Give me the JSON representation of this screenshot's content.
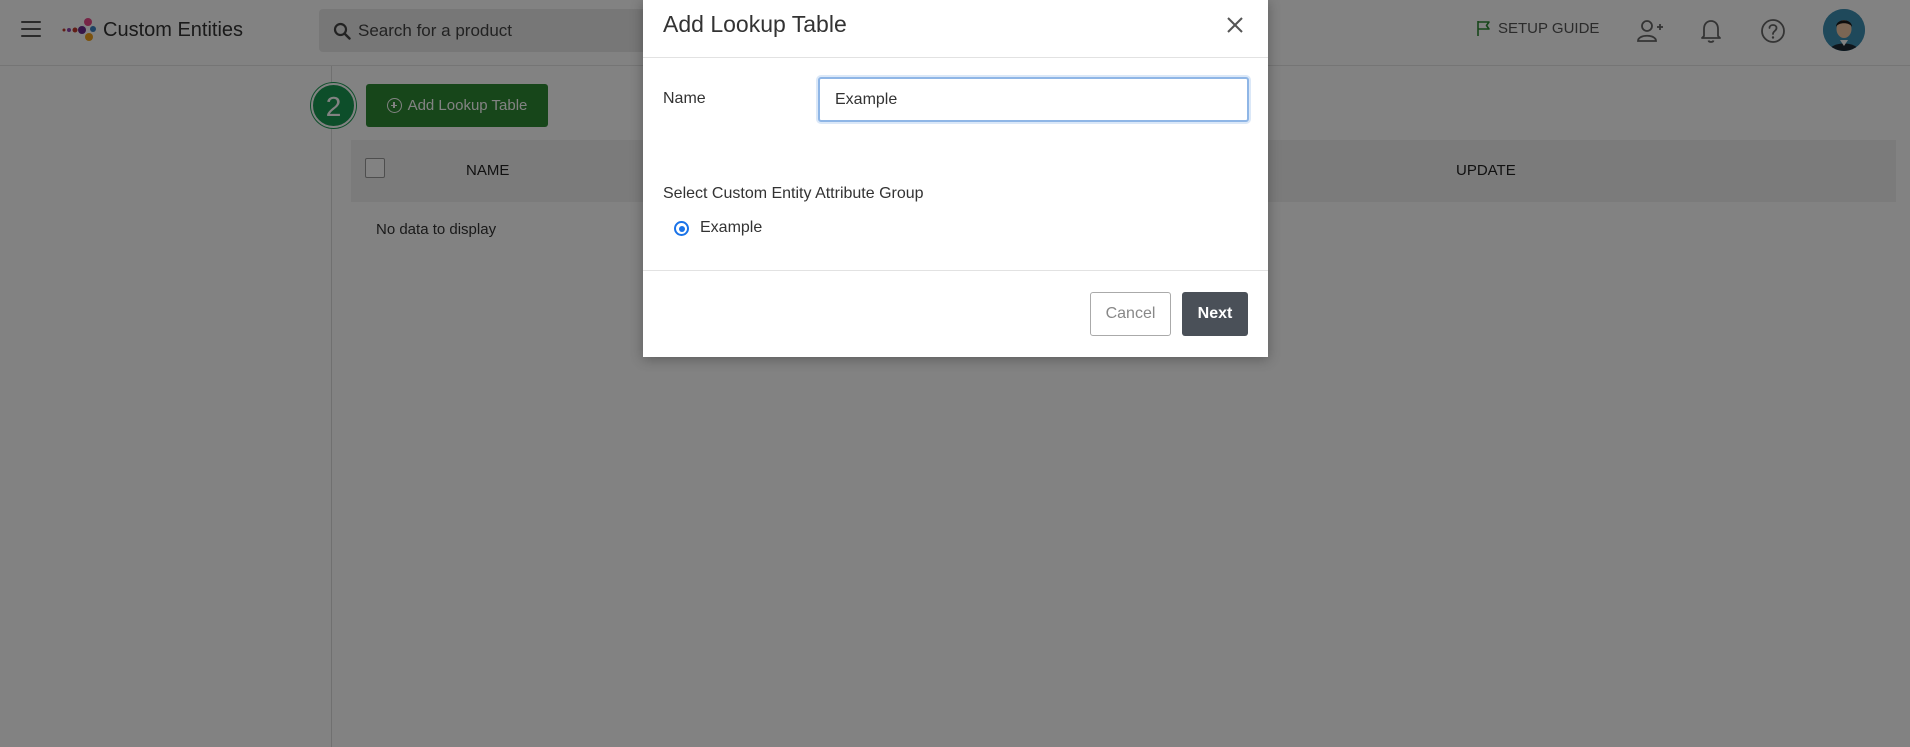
{
  "header": {
    "app_title": "Custom Entities",
    "search_placeholder": "Search for a product",
    "setup_guide_label": "SETUP GUIDE",
    "icons": [
      "menu-icon",
      "app-logo",
      "search-icon",
      "flag-icon",
      "add-user-icon",
      "bell-icon",
      "help-icon",
      "avatar"
    ]
  },
  "page": {
    "step_badge": "2",
    "add_button_label": "Add Lookup Table",
    "table": {
      "columns": [
        "NAME",
        "UPDATE"
      ],
      "empty_message": "No data to display"
    }
  },
  "modal": {
    "title": "Add Lookup Table",
    "name_label": "Name",
    "name_value": "Example",
    "group_label": "Select Custom Entity Attribute Group",
    "group_options": [
      {
        "label": "Example",
        "selected": true
      }
    ],
    "cancel_label": "Cancel",
    "next_label": "Next"
  },
  "colors": {
    "primary_green": "#2e8a34",
    "badge_green": "#1a9a53",
    "next_button": "#4a5058",
    "radio_blue": "#1a73e8"
  }
}
